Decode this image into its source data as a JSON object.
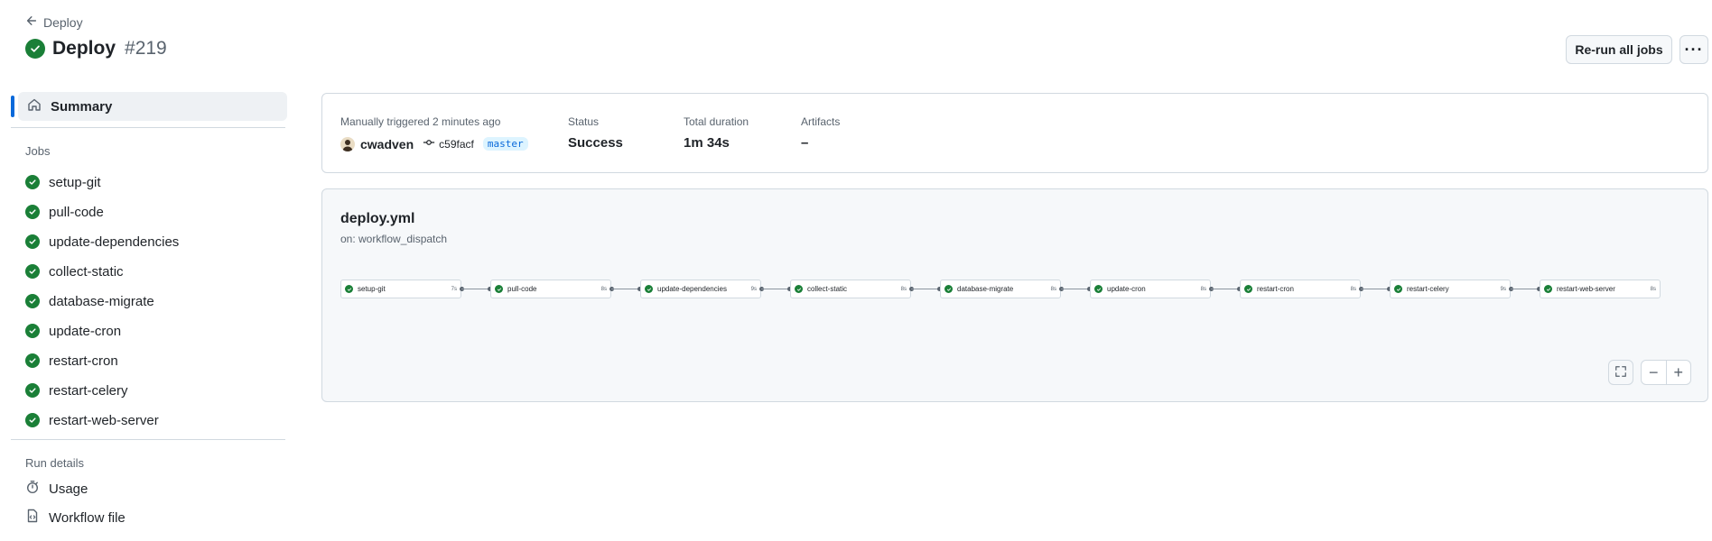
{
  "header": {
    "back_label": "Deploy",
    "title": "Deploy",
    "run_number": "#219",
    "rerun_label": "Re-run all jobs",
    "more_label": "···"
  },
  "sidebar": {
    "summary_label": "Summary",
    "jobs_heading": "Jobs",
    "jobs": [
      {
        "label": "setup-git"
      },
      {
        "label": "pull-code"
      },
      {
        "label": "update-dependencies"
      },
      {
        "label": "collect-static"
      },
      {
        "label": "database-migrate"
      },
      {
        "label": "update-cron"
      },
      {
        "label": "restart-cron"
      },
      {
        "label": "restart-celery"
      },
      {
        "label": "restart-web-server"
      }
    ],
    "run_details_heading": "Run details",
    "details": [
      {
        "label": "Usage",
        "icon": "stopwatch-icon"
      },
      {
        "label": "Workflow file",
        "icon": "file-code-icon"
      }
    ]
  },
  "summary": {
    "trigger_label": "Manually triggered 2 minutes ago",
    "user": "cwadven",
    "commit": "c59facf",
    "branch": "master",
    "status_label": "Status",
    "status_value": "Success",
    "duration_label": "Total duration",
    "duration_value": "1m 34s",
    "artifacts_label": "Artifacts",
    "artifacts_value": "–"
  },
  "workflow": {
    "file": "deploy.yml",
    "trigger": "on: workflow_dispatch",
    "nodes": [
      {
        "name": "setup-git",
        "duration": "7s"
      },
      {
        "name": "pull-code",
        "duration": "8s"
      },
      {
        "name": "update-dependencies",
        "duration": "9s"
      },
      {
        "name": "collect-static",
        "duration": "8s"
      },
      {
        "name": "database-migrate",
        "duration": "8s"
      },
      {
        "name": "update-cron",
        "duration": "8s"
      },
      {
        "name": "restart-cron",
        "duration": "8s"
      },
      {
        "name": "restart-celery",
        "duration": "9s"
      },
      {
        "name": "restart-web-server",
        "duration": "8s"
      }
    ],
    "zoom_out_label": "−",
    "zoom_in_label": "+"
  },
  "colors": {
    "success": "#1a7f37",
    "accent": "#0969da"
  }
}
